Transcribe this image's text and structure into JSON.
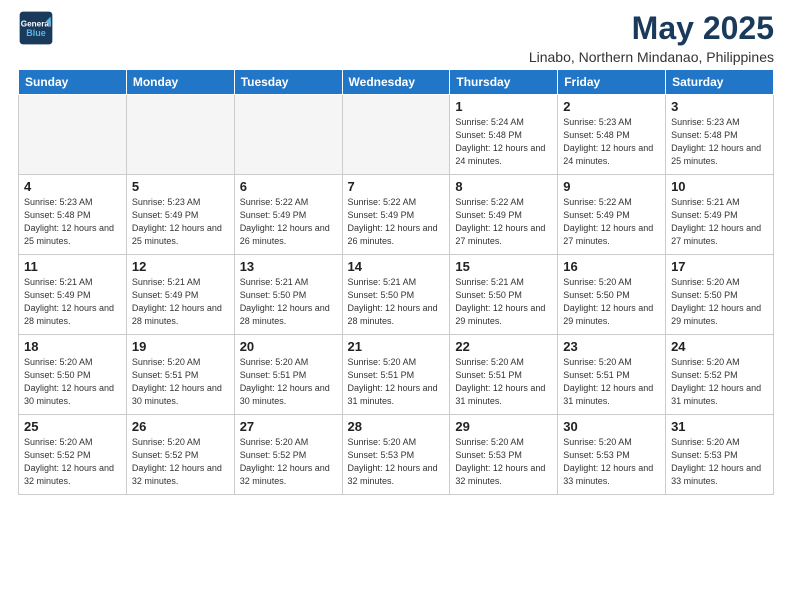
{
  "header": {
    "logo_line1": "General",
    "logo_line2": "Blue",
    "title": "May 2025",
    "subtitle": "Linabo, Northern Mindanao, Philippines"
  },
  "days_of_week": [
    "Sunday",
    "Monday",
    "Tuesday",
    "Wednesday",
    "Thursday",
    "Friday",
    "Saturday"
  ],
  "weeks": [
    [
      {
        "day": "",
        "empty": true
      },
      {
        "day": "",
        "empty": true
      },
      {
        "day": "",
        "empty": true
      },
      {
        "day": "",
        "empty": true
      },
      {
        "day": "1",
        "sunrise": "5:24 AM",
        "sunset": "5:48 PM",
        "daylight": "12 hours and 24 minutes."
      },
      {
        "day": "2",
        "sunrise": "5:23 AM",
        "sunset": "5:48 PM",
        "daylight": "12 hours and 24 minutes."
      },
      {
        "day": "3",
        "sunrise": "5:23 AM",
        "sunset": "5:48 PM",
        "daylight": "12 hours and 25 minutes."
      }
    ],
    [
      {
        "day": "4",
        "sunrise": "5:23 AM",
        "sunset": "5:48 PM",
        "daylight": "12 hours and 25 minutes."
      },
      {
        "day": "5",
        "sunrise": "5:23 AM",
        "sunset": "5:49 PM",
        "daylight": "12 hours and 25 minutes."
      },
      {
        "day": "6",
        "sunrise": "5:22 AM",
        "sunset": "5:49 PM",
        "daylight": "12 hours and 26 minutes."
      },
      {
        "day": "7",
        "sunrise": "5:22 AM",
        "sunset": "5:49 PM",
        "daylight": "12 hours and 26 minutes."
      },
      {
        "day": "8",
        "sunrise": "5:22 AM",
        "sunset": "5:49 PM",
        "daylight": "12 hours and 27 minutes."
      },
      {
        "day": "9",
        "sunrise": "5:22 AM",
        "sunset": "5:49 PM",
        "daylight": "12 hours and 27 minutes."
      },
      {
        "day": "10",
        "sunrise": "5:21 AM",
        "sunset": "5:49 PM",
        "daylight": "12 hours and 27 minutes."
      }
    ],
    [
      {
        "day": "11",
        "sunrise": "5:21 AM",
        "sunset": "5:49 PM",
        "daylight": "12 hours and 28 minutes."
      },
      {
        "day": "12",
        "sunrise": "5:21 AM",
        "sunset": "5:49 PM",
        "daylight": "12 hours and 28 minutes."
      },
      {
        "day": "13",
        "sunrise": "5:21 AM",
        "sunset": "5:50 PM",
        "daylight": "12 hours and 28 minutes."
      },
      {
        "day": "14",
        "sunrise": "5:21 AM",
        "sunset": "5:50 PM",
        "daylight": "12 hours and 28 minutes."
      },
      {
        "day": "15",
        "sunrise": "5:21 AM",
        "sunset": "5:50 PM",
        "daylight": "12 hours and 29 minutes."
      },
      {
        "day": "16",
        "sunrise": "5:20 AM",
        "sunset": "5:50 PM",
        "daylight": "12 hours and 29 minutes."
      },
      {
        "day": "17",
        "sunrise": "5:20 AM",
        "sunset": "5:50 PM",
        "daylight": "12 hours and 29 minutes."
      }
    ],
    [
      {
        "day": "18",
        "sunrise": "5:20 AM",
        "sunset": "5:50 PM",
        "daylight": "12 hours and 30 minutes."
      },
      {
        "day": "19",
        "sunrise": "5:20 AM",
        "sunset": "5:51 PM",
        "daylight": "12 hours and 30 minutes."
      },
      {
        "day": "20",
        "sunrise": "5:20 AM",
        "sunset": "5:51 PM",
        "daylight": "12 hours and 30 minutes."
      },
      {
        "day": "21",
        "sunrise": "5:20 AM",
        "sunset": "5:51 PM",
        "daylight": "12 hours and 31 minutes."
      },
      {
        "day": "22",
        "sunrise": "5:20 AM",
        "sunset": "5:51 PM",
        "daylight": "12 hours and 31 minutes."
      },
      {
        "day": "23",
        "sunrise": "5:20 AM",
        "sunset": "5:51 PM",
        "daylight": "12 hours and 31 minutes."
      },
      {
        "day": "24",
        "sunrise": "5:20 AM",
        "sunset": "5:52 PM",
        "daylight": "12 hours and 31 minutes."
      }
    ],
    [
      {
        "day": "25",
        "sunrise": "5:20 AM",
        "sunset": "5:52 PM",
        "daylight": "12 hours and 32 minutes."
      },
      {
        "day": "26",
        "sunrise": "5:20 AM",
        "sunset": "5:52 PM",
        "daylight": "12 hours and 32 minutes."
      },
      {
        "day": "27",
        "sunrise": "5:20 AM",
        "sunset": "5:52 PM",
        "daylight": "12 hours and 32 minutes."
      },
      {
        "day": "28",
        "sunrise": "5:20 AM",
        "sunset": "5:53 PM",
        "daylight": "12 hours and 32 minutes."
      },
      {
        "day": "29",
        "sunrise": "5:20 AM",
        "sunset": "5:53 PM",
        "daylight": "12 hours and 32 minutes."
      },
      {
        "day": "30",
        "sunrise": "5:20 AM",
        "sunset": "5:53 PM",
        "daylight": "12 hours and 33 minutes."
      },
      {
        "day": "31",
        "sunrise": "5:20 AM",
        "sunset": "5:53 PM",
        "daylight": "12 hours and 33 minutes."
      }
    ]
  ],
  "labels": {
    "sunrise": "Sunrise:",
    "sunset": "Sunset:",
    "daylight": "Daylight:"
  }
}
